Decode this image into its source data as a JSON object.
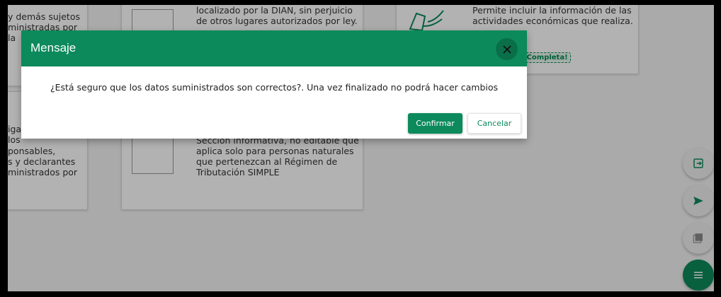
{
  "cards": {
    "left_top": {
      "line1": "y demás sujetos",
      "line2": "ministradas por la"
    },
    "left_bottom": {
      "line1": "igad",
      "line2": "los",
      "line3": "ponsables,",
      "line4": "s y declarantes",
      "line5": "ministrados por"
    },
    "center_top": {
      "line1": "localizado por la DIAN, sin perjuicio",
      "line2": "de otros lugares autorizados por ley."
    },
    "center_bottom": {
      "line0": "Sección informativa, no editable que",
      "line1": "aplica solo para personas naturales",
      "line2": "que pertenezcan al Régimen de",
      "line3": "Tributación SIMPLE"
    },
    "right_top": {
      "line1": "Permite incluir la información de las",
      "line2": "actividades económicas que realiza.",
      "badge": "¡Completa!"
    }
  },
  "modal": {
    "title": "Mensaje",
    "message": "¿Está seguro que los datos suministrados son correctos?. Una vez finalizado no podrá hacer cambios",
    "confirm_label": "Confirmar",
    "cancel_label": "Cancelar"
  },
  "fabs": {
    "exit_icon": "exit-icon",
    "send_icon": "send-icon",
    "pdf_icon": "pdf-icon",
    "menu_icon": "menu-icon"
  },
  "colors": {
    "primary": "#0c8a5b",
    "overlay": "rgba(0,0,0,0.30)"
  }
}
